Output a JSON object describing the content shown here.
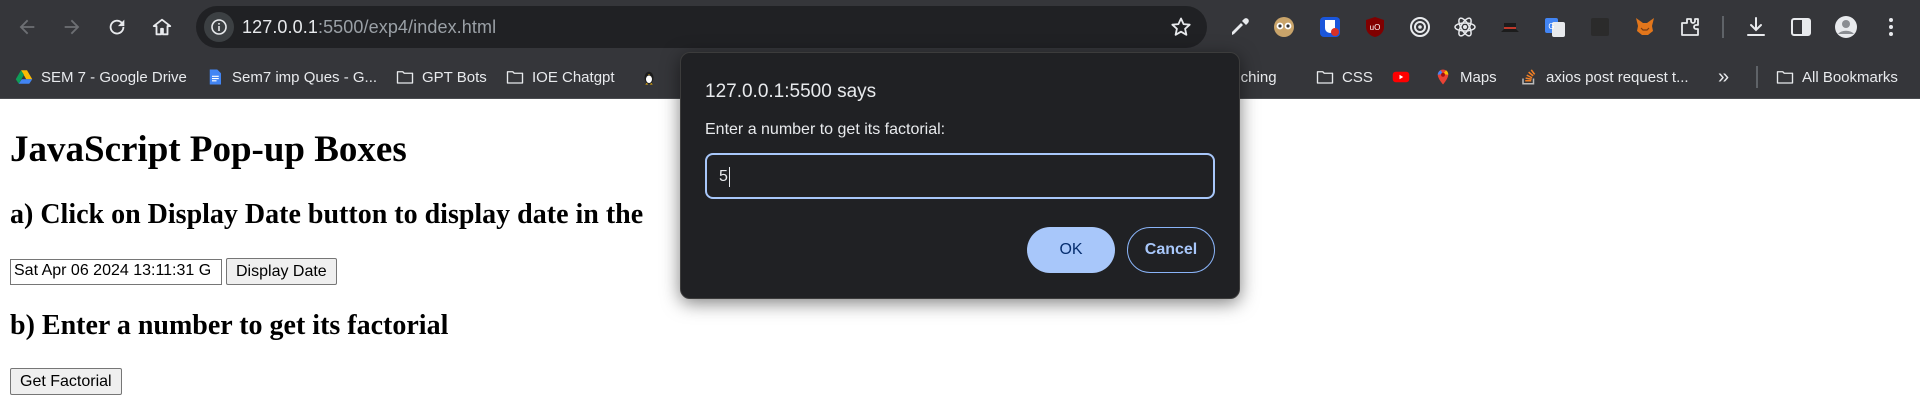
{
  "browser": {
    "url_host": "127.0.0.1",
    "url_rest": ":5500/exp4/index.html",
    "extensions": [
      "eyedropper-icon",
      "owl-icon",
      "bitwarden-icon",
      "ublock-icon",
      "target-icon",
      "react-icon",
      "hat-icon",
      "google-translate-icon",
      "dark-square-icon",
      "metamask-fox-icon",
      "puzzle-icon"
    ],
    "bookmarks": [
      {
        "label": "SEM 7 - Google Drive",
        "icon": "google-drive-icon"
      },
      {
        "label": "Sem7 imp Ques - G...",
        "icon": "google-docs-icon"
      },
      {
        "label": "GPT Bots",
        "icon": "folder-icon"
      },
      {
        "label": "IOE Chatgpt",
        "icon": "folder-icon"
      },
      {
        "label": "",
        "icon": "linux-penguin-icon"
      },
      {
        "label": "anching",
        "icon": ""
      },
      {
        "label": "CSS",
        "icon": "folder-icon"
      },
      {
        "label": "",
        "icon": "youtube-icon"
      },
      {
        "label": "Maps",
        "icon": "google-maps-icon"
      },
      {
        "label": "axios post request t...",
        "icon": "stackoverflow-icon"
      }
    ],
    "more_bookmarks": "»",
    "all_bookmarks": "All Bookmarks"
  },
  "page": {
    "title": "JavaScript Pop-up Boxes",
    "section_a": "a) Click on Display Date button to display date in the",
    "date_value": "Sat Apr 06 2024 13:11:31 G",
    "display_date_button": "Display Date",
    "section_b": "b) Enter a number to get its factorial",
    "factorial_button": "Get Factorial"
  },
  "dialog": {
    "title": "127.0.0.1:5500 says",
    "message": "Enter a number to get its factorial:",
    "input_value": "5",
    "ok_label": "OK",
    "cancel_label": "Cancel"
  }
}
